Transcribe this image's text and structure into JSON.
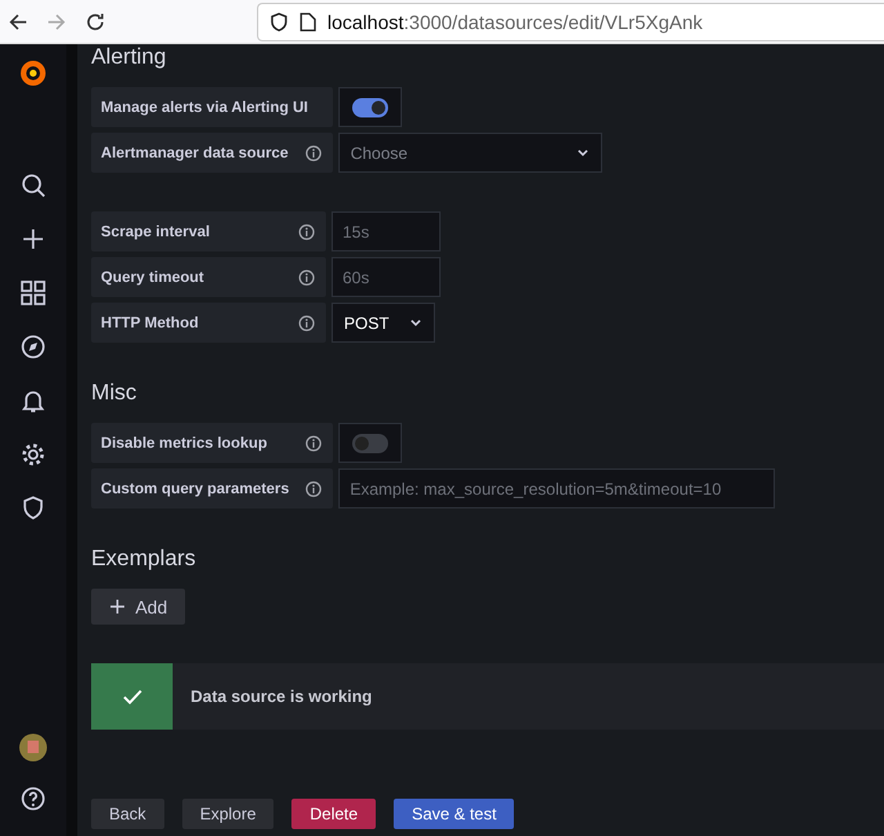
{
  "browser": {
    "url_host": "localhost",
    "url_rest": ":3000/datasources/edit/VLr5XgAnk"
  },
  "sections": [
    {
      "title": "Alerting",
      "rows": [
        {
          "kind": "switch",
          "label": "Manage alerts via Alerting UI",
          "info": false,
          "on": true
        },
        {
          "kind": "select",
          "label": "Alertmanager data source",
          "info": true,
          "placeholder": "Choose"
        }
      ]
    },
    {
      "rows": [
        {
          "kind": "input",
          "label": "Scrape interval",
          "info": true,
          "placeholder": "15s"
        },
        {
          "kind": "input",
          "label": "Query timeout",
          "info": true,
          "placeholder": "60s"
        },
        {
          "kind": "select",
          "label": "HTTP Method",
          "info": true,
          "value": "POST"
        }
      ]
    },
    {
      "title": "Misc",
      "rows": [
        {
          "kind": "switch",
          "label": "Disable metrics lookup",
          "info": true,
          "on": false
        },
        {
          "kind": "input",
          "label": "Custom query parameters",
          "info": true,
          "placeholder": "Example: max_source_resolution=5m&timeout=10"
        }
      ]
    },
    {
      "title": "Exemplars",
      "add_button": "Add"
    }
  ],
  "alert": {
    "kind": "success",
    "text": "Data source is working"
  },
  "buttons": [
    {
      "label": "Back",
      "kind": "secondary"
    },
    {
      "label": "Explore",
      "kind": "secondary"
    },
    {
      "label": "Delete",
      "kind": "destructive"
    },
    {
      "label": "Save & test",
      "kind": "primary"
    }
  ]
}
